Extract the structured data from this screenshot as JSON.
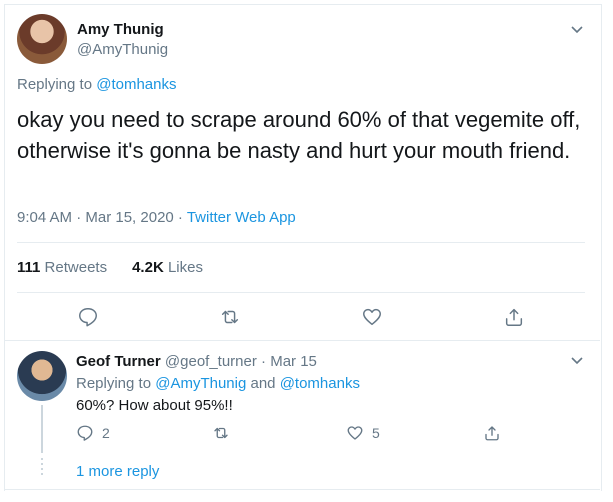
{
  "main_tweet": {
    "author_name": "Amy Thunig",
    "author_handle": "@AmyThunig",
    "replying_prefix": "Replying to",
    "replying_to": "@tomhanks",
    "text": "okay you need to scrape around 60% of that vegemite off, otherwise it's gonna be nasty and hurt your mouth friend.",
    "timestamp": "9:04 AM · Mar 15, 2020 · ",
    "source": "Twitter Web App",
    "retweet_count": "111",
    "retweet_label": "Retweets",
    "like_count": "4.2K",
    "like_label": "Likes"
  },
  "reply_tweet": {
    "author_name": "Geof Turner",
    "author_handle": "@geof_turner",
    "separator": "·",
    "date": "Mar 15",
    "replying_prefix": "Replying to",
    "replying_to_1": "@AmyThunig",
    "and_word": "and",
    "replying_to_2": "@tomhanks",
    "text": "60%? How about 95%!!",
    "reply_count": "2",
    "retweet_count": "",
    "like_count": "5"
  },
  "thread": {
    "more_replies_label": "1 more reply"
  },
  "colors": {
    "accent": "#1b95e0",
    "muted": "#657786",
    "text": "#14171a",
    "divider": "#e6ecf0"
  },
  "icons": [
    "chevron-down-icon",
    "reply-icon",
    "retweet-icon",
    "heart-icon",
    "share-icon"
  ]
}
